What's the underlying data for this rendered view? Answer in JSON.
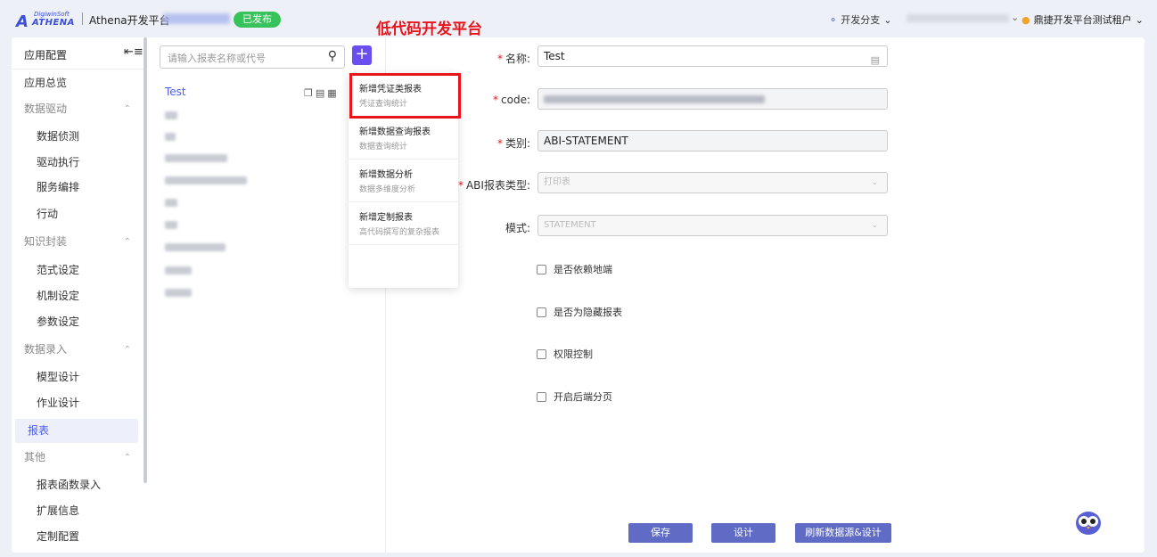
{
  "header": {
    "logo_top": "DigiwinSoft",
    "logo_text": "ATHENA",
    "title": "Athena开发平台",
    "status_badge": "已发布",
    "annotation": "低代码开发平台",
    "branch": "开发分支",
    "tenant": "鼎捷开发平台测试租户"
  },
  "sidebar": {
    "title": "应用配置",
    "items": [
      {
        "label": "应用总览",
        "kind": "top"
      },
      {
        "label": "数据驱动",
        "kind": "group"
      },
      {
        "label": "数据侦测",
        "kind": "sub"
      },
      {
        "label": "驱动执行",
        "kind": "sub"
      },
      {
        "label": "服务编排",
        "kind": "sub"
      },
      {
        "label": "行动",
        "kind": "sub"
      },
      {
        "label": "知识封装",
        "kind": "group"
      },
      {
        "label": "范式设定",
        "kind": "sub"
      },
      {
        "label": "机制设定",
        "kind": "sub"
      },
      {
        "label": "参数设定",
        "kind": "sub"
      },
      {
        "label": "数据录入",
        "kind": "group"
      },
      {
        "label": "模型设计",
        "kind": "sub"
      },
      {
        "label": "作业设计",
        "kind": "sub"
      },
      {
        "label": "报表",
        "kind": "active"
      },
      {
        "label": "其他",
        "kind": "group"
      },
      {
        "label": "报表函数录入",
        "kind": "sub"
      },
      {
        "label": "扩展信息",
        "kind": "sub"
      },
      {
        "label": "定制配置",
        "kind": "sub"
      }
    ]
  },
  "report_list": {
    "search_placeholder": "请输入报表名称或代号",
    "add_label": "+",
    "active_item": "Test"
  },
  "dropdown": [
    {
      "title": "新增凭证类报表",
      "subtitle": "凭证查询统计"
    },
    {
      "title": "新增数据查询报表",
      "subtitle": "数据查询统计"
    },
    {
      "title": "新增数据分析",
      "subtitle": "数据多维度分析"
    },
    {
      "title": "新增定制报表",
      "subtitle": "高代码撰写的复杂报表"
    }
  ],
  "form": {
    "name_label": "名称:",
    "name_value": "Test",
    "code_label": "code:",
    "type_label": "类别:",
    "type_value": "ABI-STATEMENT",
    "abi_label": "ABI报表类型:",
    "abi_value": "打印表",
    "mode_label": "模式:",
    "mode_value": "STATEMENT",
    "checkboxes": [
      "是否依赖地端",
      "是否为隐藏报表",
      "权限控制",
      "开启后端分页"
    ]
  },
  "actions": {
    "save": "保存",
    "design": "设计",
    "refresh_design": "刷新数据源&设计"
  }
}
